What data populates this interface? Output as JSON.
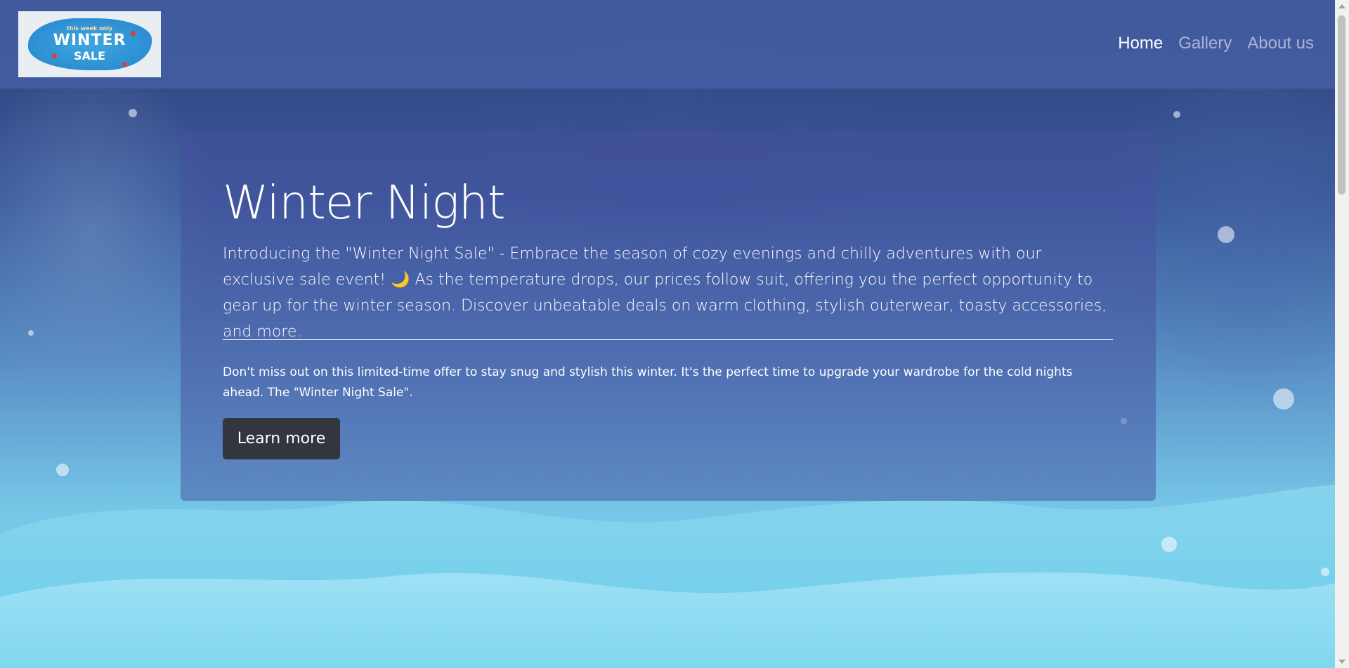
{
  "logo": {
    "tagline": "this week only",
    "title": "WINTER",
    "subtitle": "SALE"
  },
  "nav": {
    "items": [
      {
        "label": "Home",
        "active": true
      },
      {
        "label": "Gallery",
        "active": false
      },
      {
        "label": "About us",
        "active": false
      }
    ]
  },
  "hero": {
    "title": "Winter Night",
    "lead": "Introducing the \"Winter Night Sale\" - Embrace the season of cozy evenings and chilly adventures with our exclusive sale event! 🌙 As the temperature drops, our prices follow suit, offering you the perfect opportunity to gear up for the winter season. Discover unbeatable deals on warm clothing, stylish outerwear, toasty accessories, and more.",
    "body": "Don't miss out on this limited-time offer to stay snug and stylish this winter. It's the perfect time to upgrade your wardrobe for the cold nights ahead. The \"Winter Night Sale\".",
    "button_label": "Learn more"
  },
  "colors": {
    "navbar": "#465fa5",
    "hero_card": "#4650a0",
    "button": "#33363f",
    "text": "#ffffff",
    "inactive_link": "#a9b4d6"
  }
}
